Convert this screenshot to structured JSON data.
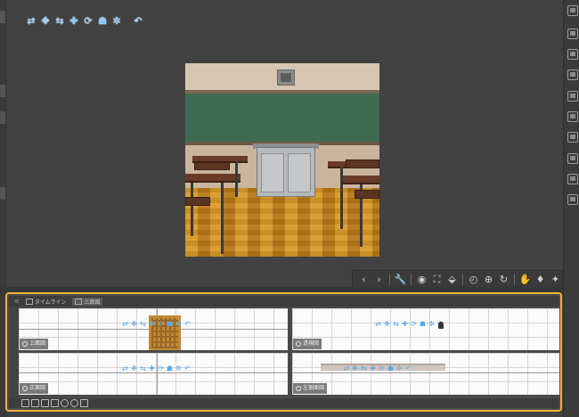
{
  "app": {
    "accent_color": "#f0b43c",
    "background_color": "#424242"
  },
  "object_toolbar": {
    "buttons": [
      {
        "name": "move-camera-icon",
        "glyph": "⇄"
      },
      {
        "name": "pan-icon",
        "glyph": "✥"
      },
      {
        "name": "slide-icon",
        "glyph": "⇆"
      },
      {
        "name": "rotate-icon",
        "glyph": "✚"
      },
      {
        "name": "scale-icon",
        "glyph": "⟳"
      },
      {
        "name": "pose-icon",
        "glyph": "☗"
      },
      {
        "name": "settings-icon",
        "glyph": "✲"
      },
      {
        "name": "undo-icon",
        "glyph": "↶"
      }
    ]
  },
  "view_tools": {
    "buttons": [
      {
        "name": "prev-icon",
        "glyph": "‹"
      },
      {
        "name": "next-icon",
        "glyph": "›"
      },
      {
        "name": "wrench-icon",
        "glyph": "🔧"
      },
      {
        "name": "camera-icon",
        "glyph": "◉"
      },
      {
        "name": "fit-icon",
        "glyph": "⛶"
      },
      {
        "name": "ground-icon",
        "glyph": "⬙"
      },
      {
        "name": "clock-icon",
        "glyph": "◴"
      },
      {
        "name": "zoom-icon",
        "glyph": "⊕"
      },
      {
        "name": "rotate-view-icon",
        "glyph": "↻"
      },
      {
        "name": "hand-icon",
        "glyph": "✋"
      },
      {
        "name": "bulb-icon",
        "glyph": "♦"
      },
      {
        "name": "wand-icon",
        "glyph": "✦"
      }
    ]
  },
  "palette": {
    "tabs": [
      {
        "label": "タイムライン"
      },
      {
        "label": "三面図"
      }
    ],
    "panes": [
      {
        "label": "上面図"
      },
      {
        "label": "透視図"
      },
      {
        "label": "正面図"
      },
      {
        "label": "左側面図"
      }
    ]
  }
}
